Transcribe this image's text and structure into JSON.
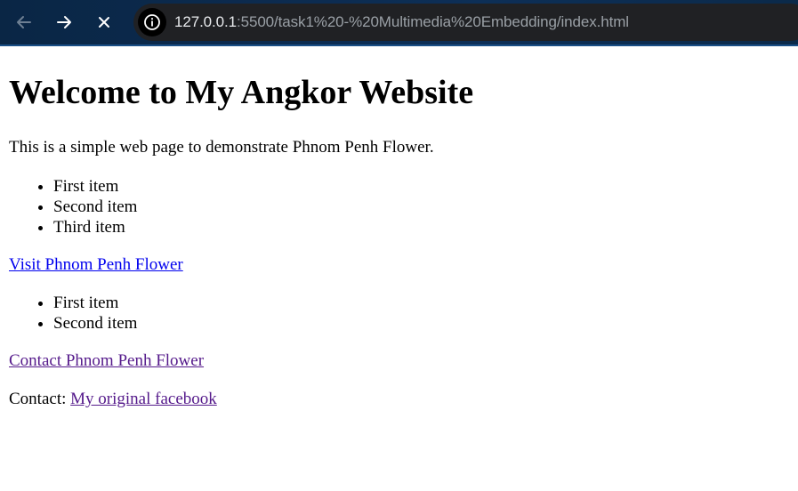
{
  "browser": {
    "url_host": "127.0.0.1",
    "url_rest": ":5500/task1%20-%20Multimedia%20Embedding/index.html",
    "icons": {
      "back": "arrow-left-icon",
      "forward": "arrow-right-icon",
      "stop": "close-icon",
      "site_info": "info-icon"
    },
    "colors": {
      "toolbar": "#0b2a4a",
      "address_bar": "#202124"
    }
  },
  "page": {
    "heading": "Welcome to My Angkor Website",
    "intro": "This is a simple web page to demonstrate Phnom Penh Flower.",
    "list1": [
      "First item",
      "Second item",
      "Third item"
    ],
    "link1": "Visit Phnom Penh Flower",
    "list2": [
      "First item",
      "Second item"
    ],
    "link2": "Contact Phnom Penh Flower",
    "contact_label": "Contact: ",
    "contact_link": "My original facebook",
    "colors": {
      "link": "#0000ee",
      "visited_link": "#551a8b"
    }
  }
}
